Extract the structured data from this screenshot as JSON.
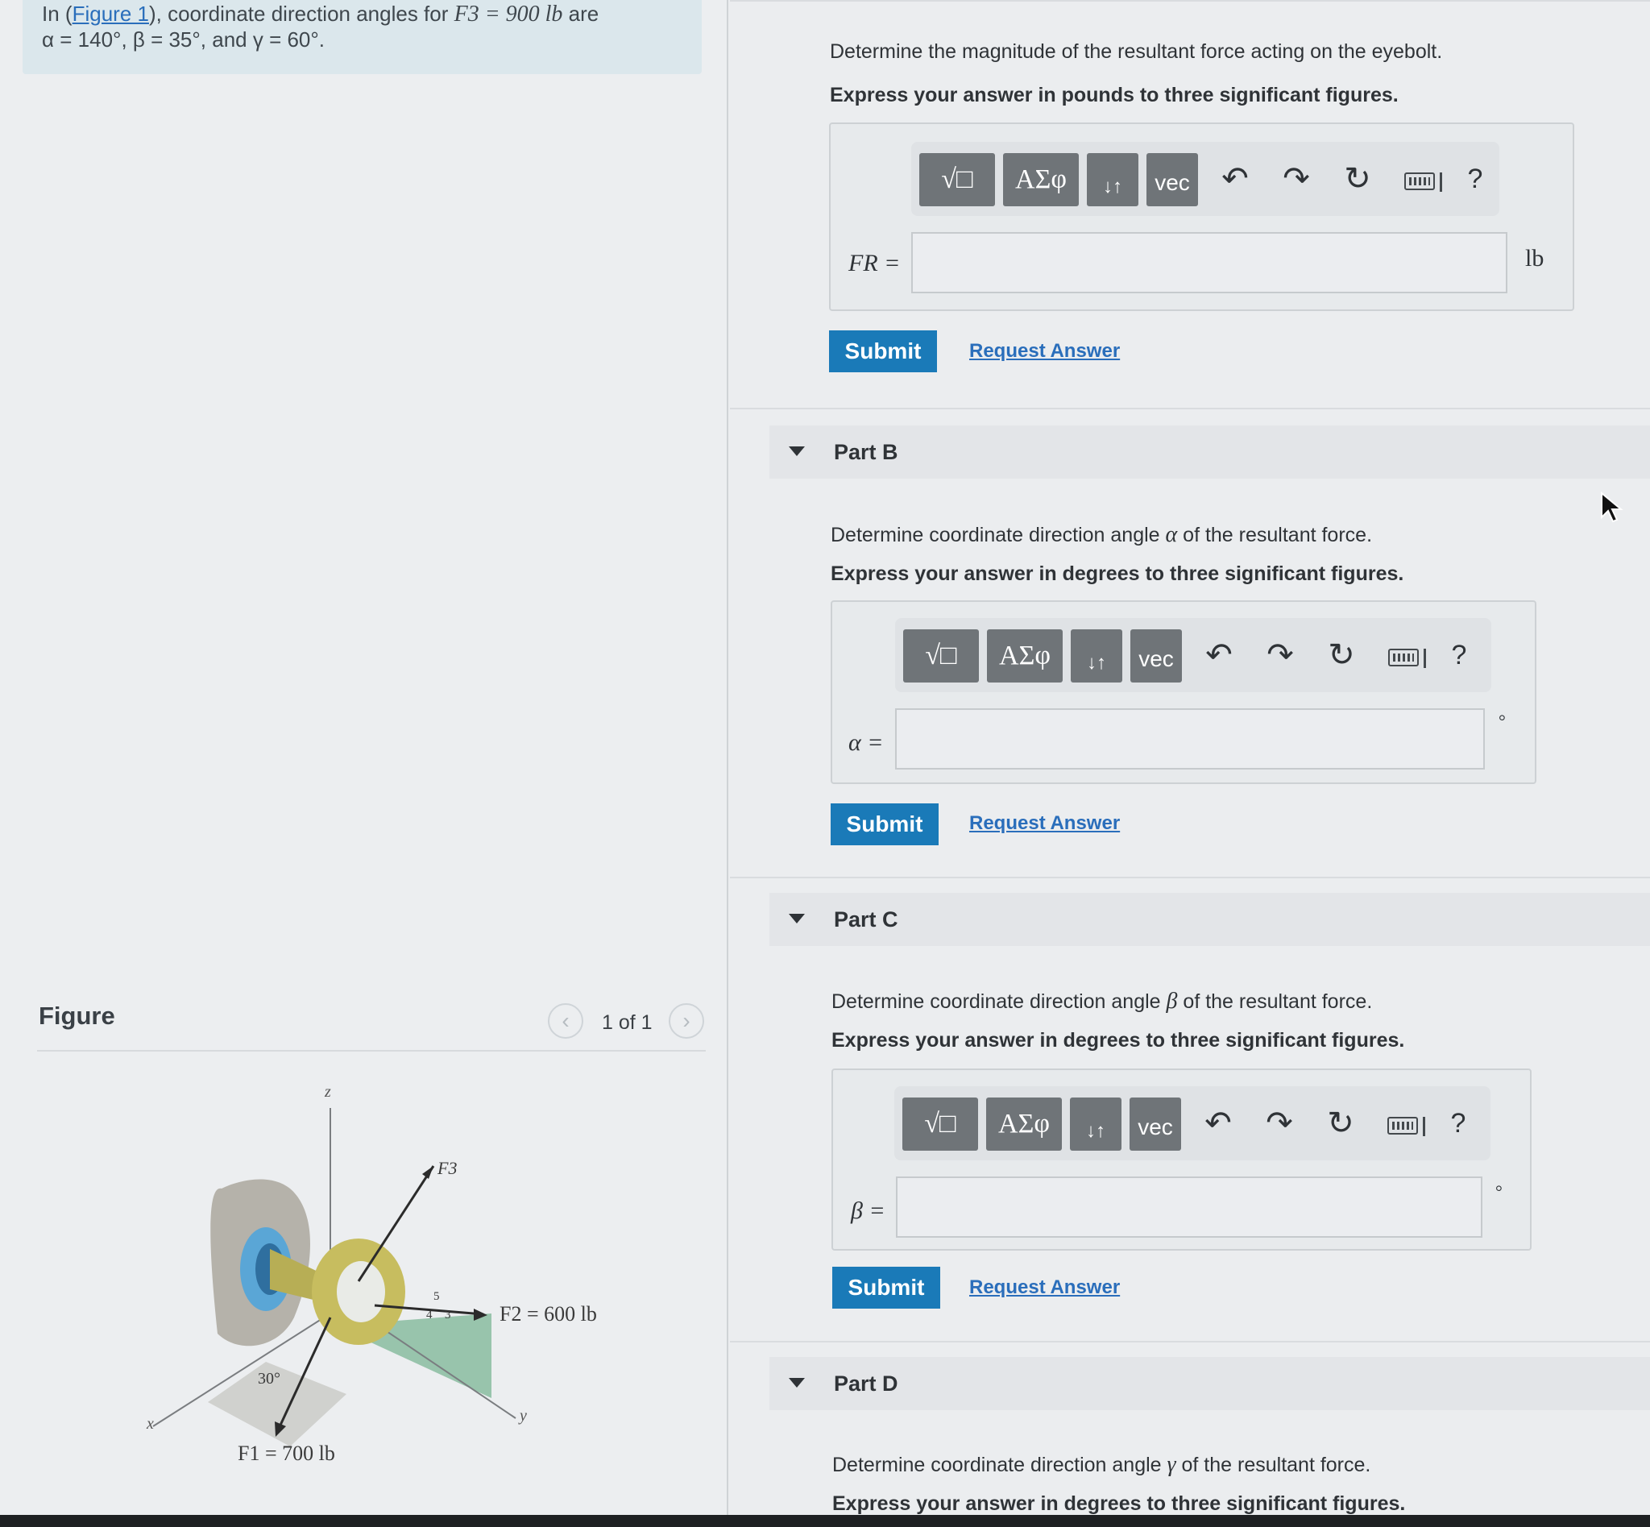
{
  "intro": {
    "line1_pre": "In (",
    "figure_link": "Figure 1",
    "line1_mid": "), coordinate direction angles for ",
    "force_symbol": "F3 = 900 lb",
    "line1_post": " are",
    "line2": "α = 140°, β = 35°, and γ = 60°."
  },
  "figure": {
    "title": "Figure",
    "page_indicator": "1 of 1",
    "prev_icon": "chevron-left-icon",
    "next_icon": "chevron-right-icon",
    "labels": {
      "z_axis": "z",
      "x_axis": "x",
      "y_axis": "y",
      "f3": "F3",
      "f2": "F2 = 600 lb",
      "f1": "F1 = 700 lb",
      "angle": "30°",
      "slope_5": "5",
      "slope_4": "4",
      "slope_3": "3"
    }
  },
  "toolbar": {
    "templates": "√□",
    "greek": "ΑΣφ",
    "arrows": "↓↑",
    "vec": "vec",
    "undo_icon": "undo-icon",
    "redo_icon": "redo-icon",
    "reset_icon": "reset-icon",
    "keyboard_icon": "keyboard-icon",
    "help": "?"
  },
  "part_a": {
    "prompt": "Determine the magnitude of the resultant force acting on the eyebolt.",
    "instruction": "Express your answer in pounds to three significant figures.",
    "field_label": "FR =",
    "unit": "lb",
    "submit": "Submit",
    "request": "Request Answer"
  },
  "part_b": {
    "header": "Part B",
    "prompt_pre": "Determine coordinate direction angle ",
    "angle_symbol": "α",
    "prompt_post": " of the resultant force.",
    "instruction": "Express your answer in degrees to three significant figures.",
    "field_label": "α =",
    "unit": "°",
    "submit": "Submit",
    "request": "Request Answer"
  },
  "part_c": {
    "header": "Part C",
    "prompt_pre": "Determine coordinate direction angle ",
    "angle_symbol": "β",
    "prompt_post": " of the resultant force.",
    "instruction": "Express your answer in degrees to three significant figures.",
    "field_label": "β =",
    "unit": "°",
    "submit": "Submit",
    "request": "Request Answer"
  },
  "part_d": {
    "header": "Part D",
    "prompt_pre": "Determine coordinate direction angle ",
    "angle_symbol": "γ",
    "prompt_post": " of the resultant force.",
    "instruction": "Express your answer in degrees to three significant figures."
  },
  "colors": {
    "submit_bg": "#1a7ab8",
    "link": "#2a6ebb",
    "intro_bg": "#dbe7ec",
    "toolbar_button": "#6f7478"
  }
}
